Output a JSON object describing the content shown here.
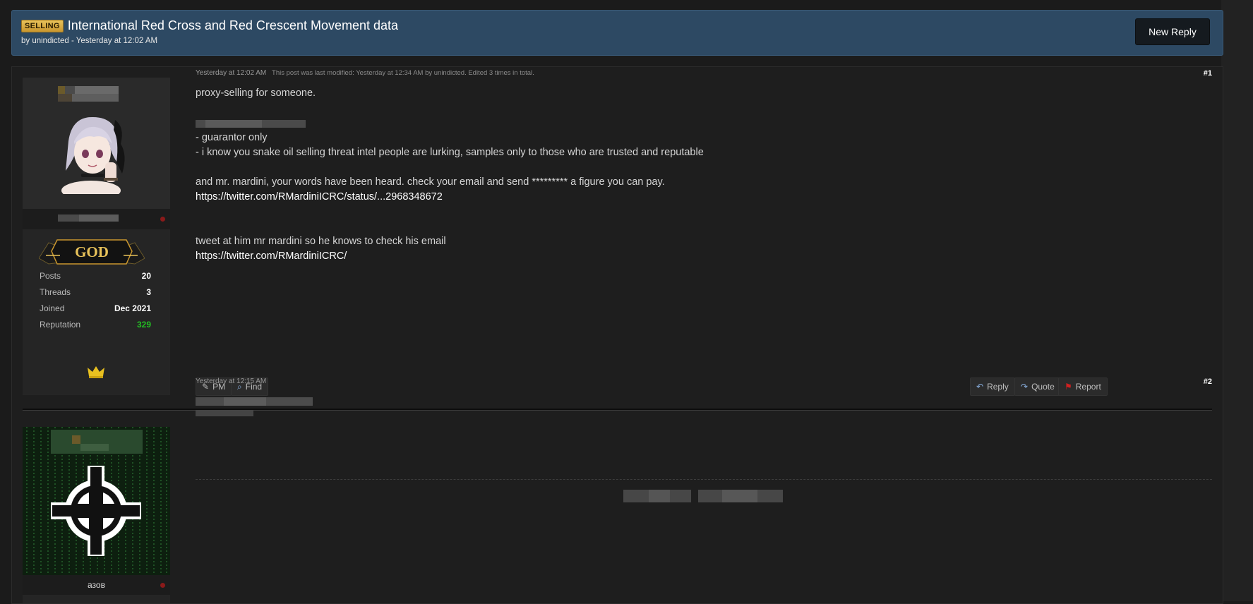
{
  "thread": {
    "badge": "SELLING",
    "title": "International Red Cross and Red Crescent Movement data",
    "meta": "by unindicted - Yesterday at 12:02 AM",
    "new_reply_label": "New Reply"
  },
  "post1": {
    "timestamp": "Yesterday at 12:02 AM",
    "modified": "This post was last modified: Yesterday at 12:34 AM by unindicted. Edited 3 times in total.",
    "number": "#1",
    "lines": {
      "l1": "proxy-selling for someone.",
      "l3": "- guarantor only",
      "l4": "- i know you snake oil selling threat intel people are lurking, samples only to those who are trusted and reputable",
      "l6": "and mr. mardini, your words have been heard. check your email and send ********* a figure you can pay.",
      "l7": "https://twitter.com/RMardiniICRC/status/...2968348672",
      "l10": "tweet at him mr mardini so he knows to check his email",
      "l11": "https://twitter.com/RMardiniICRC/"
    },
    "user": {
      "rank": "GOD",
      "stats": [
        {
          "label": "Posts",
          "value": "20"
        },
        {
          "label": "Threads",
          "value": "3"
        },
        {
          "label": "Joined",
          "value": "Dec 2021"
        },
        {
          "label": "Reputation",
          "value": "329"
        }
      ],
      "award_icon": "crown-icon"
    },
    "buttons": {
      "pm": "PM",
      "find": "Find",
      "reply": "Reply",
      "quote": "Quote",
      "report": "Report"
    }
  },
  "post2": {
    "timestamp": "Yesterday at 12:15 AM",
    "number": "#2",
    "username": "азов"
  },
  "colors": {
    "header_bg": "#2d4963",
    "page_bg": "#1b1b1b",
    "reputation": "#22c022",
    "rank_gold": "#e8c25a",
    "report_red": "#d02020"
  }
}
